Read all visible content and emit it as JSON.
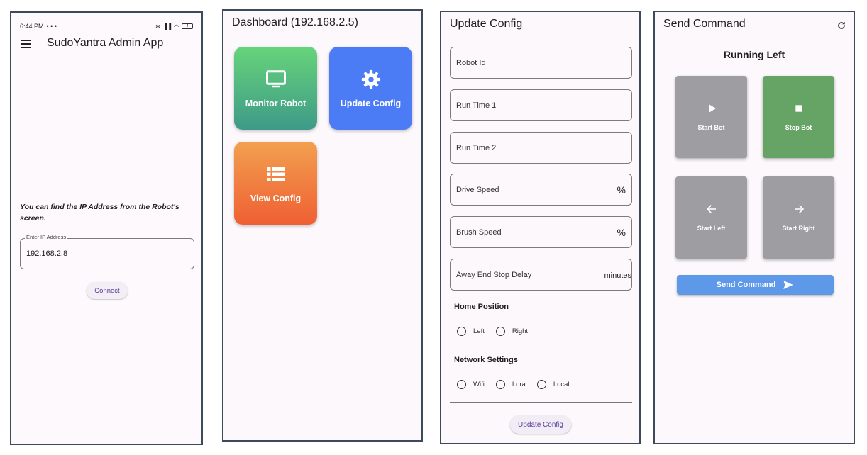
{
  "screen1": {
    "status": {
      "time": "6:44 PM",
      "extra": "• • •",
      "battery": "4"
    },
    "title": "SudoYantra Admin App",
    "hint": "You can find the IP Address from the Robot's screen.",
    "ip_label": "Enter IP Address",
    "ip_value": "192.168.2.8",
    "connect": "Connect"
  },
  "screen2": {
    "title": "Dashboard (192.168.2.5)",
    "tiles": [
      {
        "label": "Monitor Robot",
        "icon": "monitor-icon"
      },
      {
        "label": "Update Config",
        "icon": "gear-icon"
      },
      {
        "label": "View Config",
        "icon": "list-icon"
      }
    ]
  },
  "screen3": {
    "title": "Update Config",
    "fields": [
      {
        "label": "Robot Id",
        "suffix": ""
      },
      {
        "label": "Run Time 1",
        "suffix": ""
      },
      {
        "label": "Run Time 2",
        "suffix": ""
      },
      {
        "label": "Drive Speed",
        "suffix": "%"
      },
      {
        "label": "Brush Speed",
        "suffix": "%"
      },
      {
        "label": "Away End Stop Delay",
        "suffix": "minutes"
      }
    ],
    "home_section": "Home Position",
    "home_options": [
      "Left",
      "Right"
    ],
    "network_section": "Network Settings",
    "network_options": [
      "Wifi",
      "Lora",
      "Local"
    ],
    "submit": "Update Config"
  },
  "screen4": {
    "title": "Send Command",
    "status": "Running Left",
    "commands": [
      {
        "label": "Start Bot",
        "icon": "play-icon"
      },
      {
        "label": "Stop Bot",
        "icon": "stop-icon",
        "active_color": "#65a465"
      },
      {
        "label": "Start Left",
        "icon": "arrow-left-icon"
      },
      {
        "label": "Start Right",
        "icon": "arrow-right-icon"
      }
    ],
    "send": "Send Command"
  },
  "colors": {
    "accent": "#5b3e96",
    "tile_blue": "#4b7cf6",
    "send_blue": "#5e98e9",
    "stop_green": "#65a465",
    "cmd_gray": "#9e9ea2"
  }
}
